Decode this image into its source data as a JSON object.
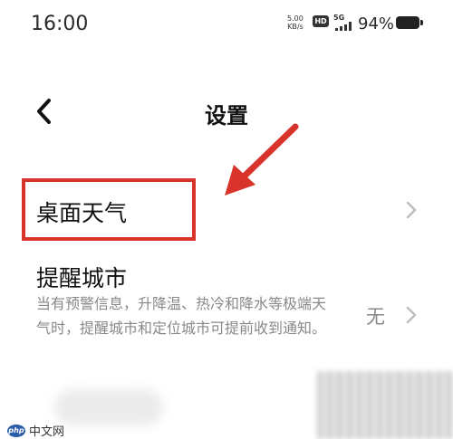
{
  "status_bar": {
    "time": "16:00",
    "net_speed": "5.00",
    "net_unit": "KB/s",
    "hd": "HD",
    "network": "5G",
    "battery": "94%"
  },
  "header": {
    "back_icon": "chevron-left-icon",
    "title": "设置"
  },
  "settings": {
    "desktop_weather": {
      "label": "桌面天气"
    },
    "remind_city": {
      "label": "提醒城市",
      "description": "当有预警信息，升降温、热冷和降水等极端天气时，提醒城市和定位城市可提前收到通知。",
      "value": "无"
    }
  },
  "annotation": {
    "color": "#d9342b",
    "icon": "arrow-annotation-icon"
  },
  "watermark": {
    "logo": "php",
    "text": "中文网"
  }
}
